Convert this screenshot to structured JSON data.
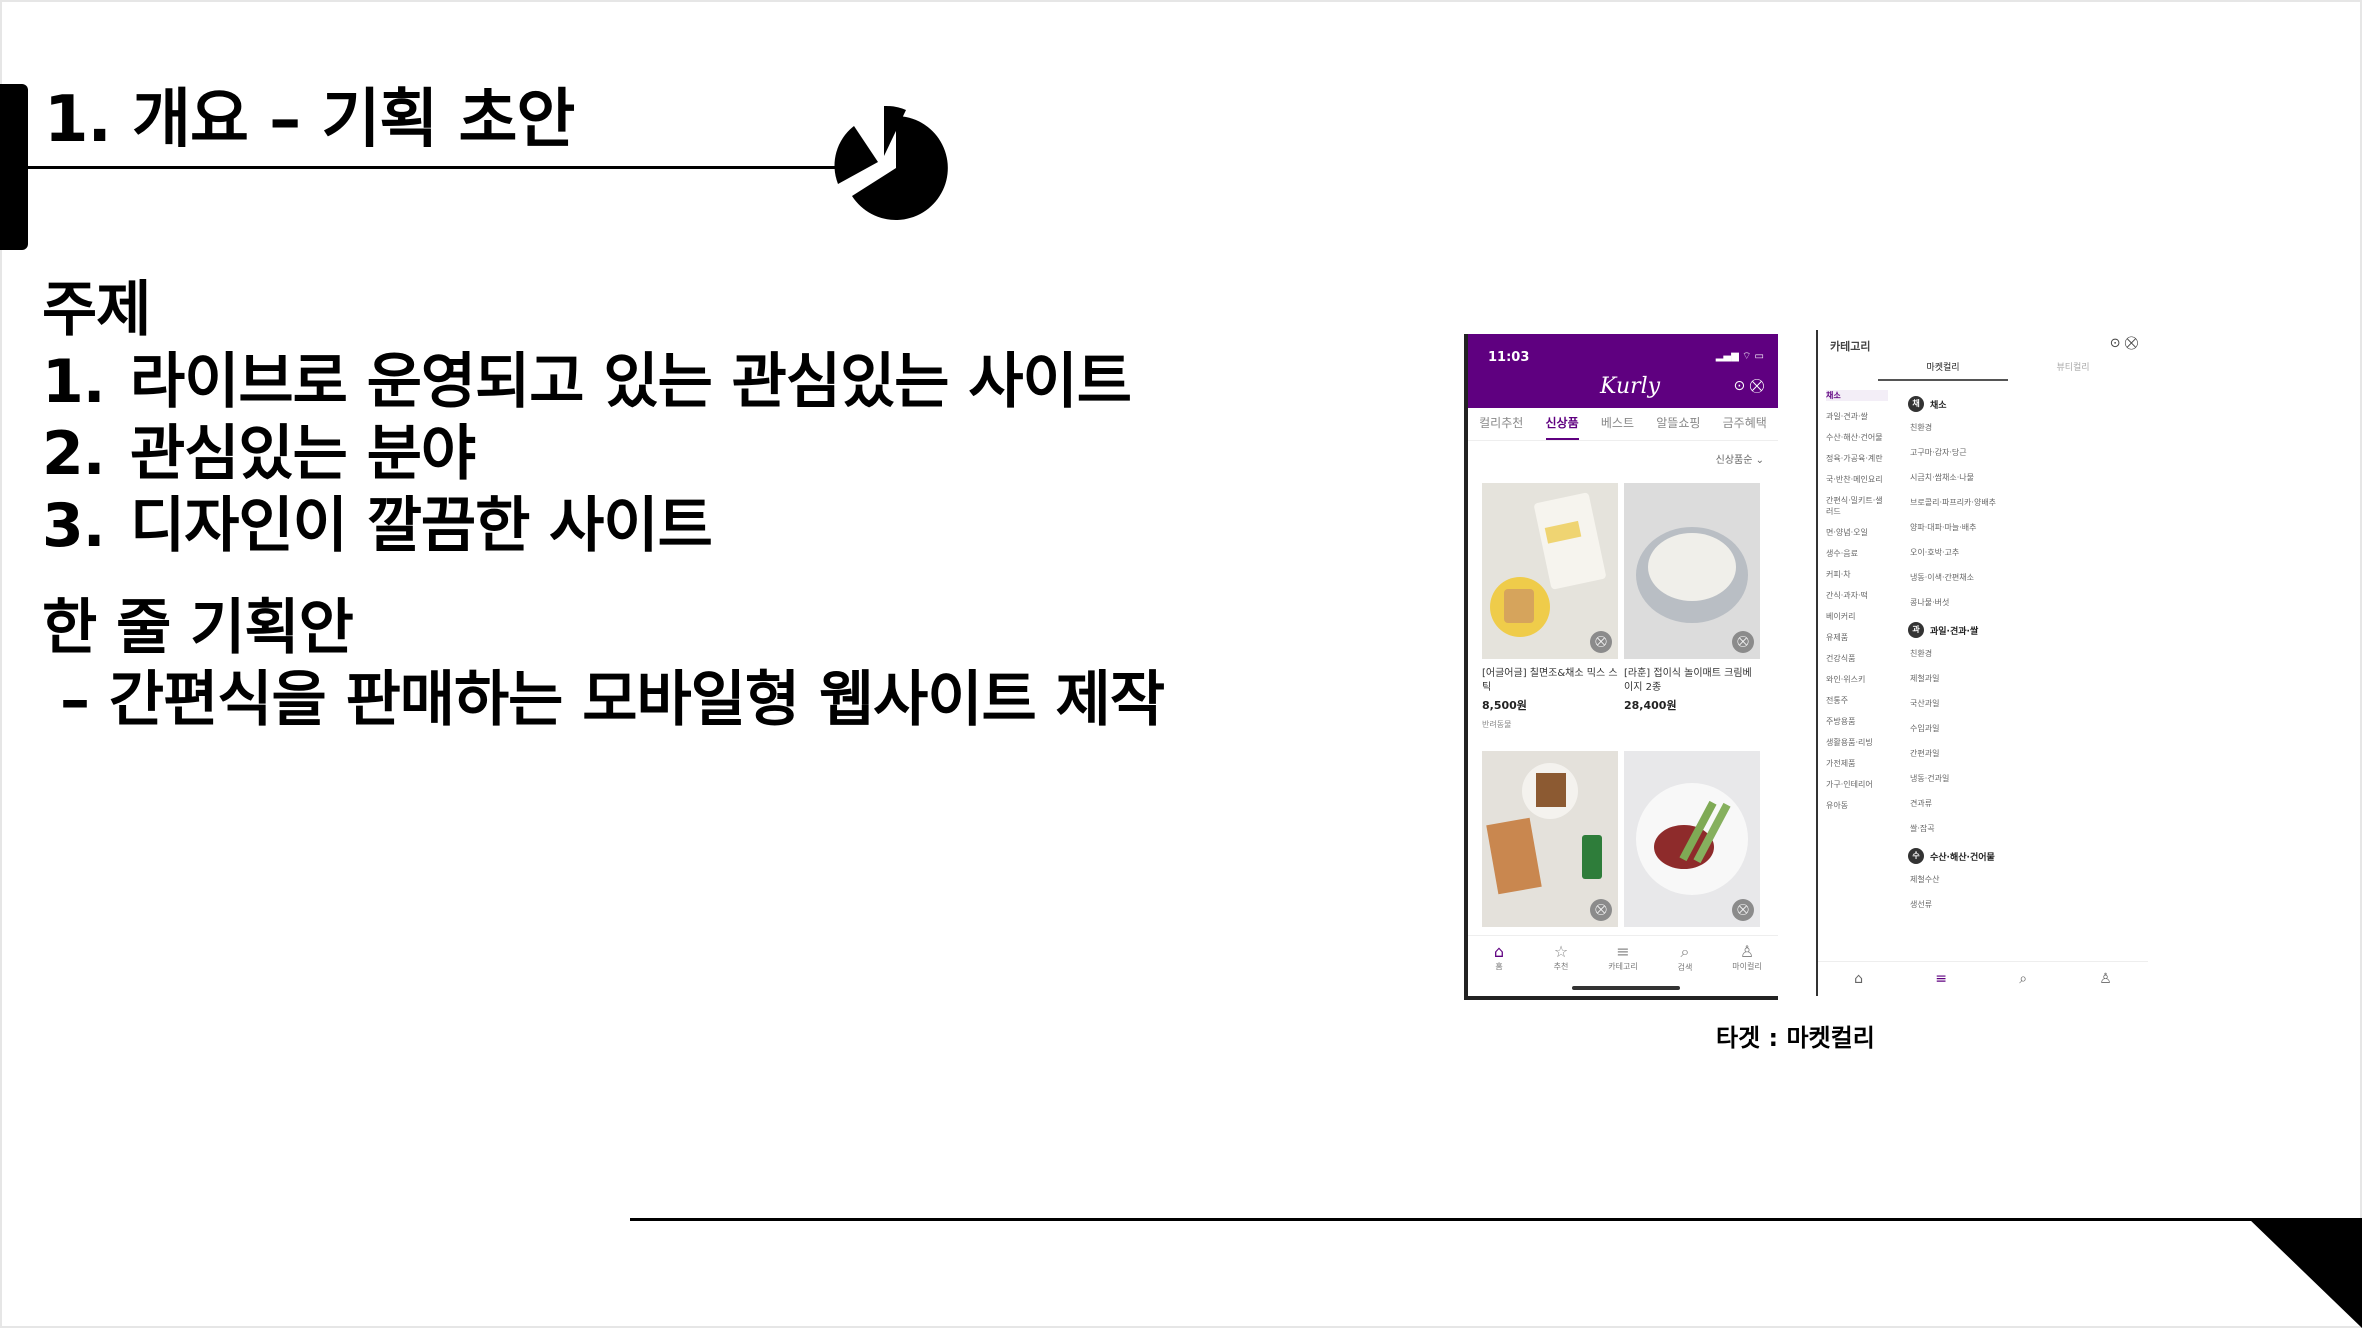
{
  "slide": {
    "title": "1. 개요 – 기획 초안",
    "topic_heading": "주제",
    "topics": [
      {
        "num": "1.",
        "text": "라이브로 운영되고 있는 관심있는 사이트"
      },
      {
        "num": "2.",
        "text": "관심있는 분야"
      },
      {
        "num": "3.",
        "text": "디자인이 깔끔한 사이트"
      }
    ],
    "plan_heading": "한 줄 기획안",
    "plan_text": "– 간편식을 판매하는 모바일형 웹사이트 제작",
    "caption": "타겟 : 마켓컬리"
  },
  "phone": {
    "time": "11:03",
    "status_icons": "▂▄▆ ⌔ ▭",
    "logo": "Kurly",
    "header_icons": "⊙ ⛒",
    "tabs": [
      "컬리추천",
      "신상품",
      "베스트",
      "알뜰쇼핑",
      "금주혜택"
    ],
    "sort_label": "신상품순 ⌄",
    "cart_glyph": "⛒",
    "products": [
      {
        "name": "[어글어글] 칠면조&채소 믹스 스틱",
        "price": "8,500원",
        "tag": "반려동물"
      },
      {
        "name": "[라훈] 접이식 놀이매트 크림베이지 2종",
        "price": "28,400원",
        "tag": ""
      },
      {
        "name": "",
        "price": "",
        "tag": ""
      },
      {
        "name": "",
        "price": "",
        "tag": ""
      }
    ],
    "nav": [
      {
        "icon": "⌂",
        "label": "홈"
      },
      {
        "icon": "☆",
        "label": "추천"
      },
      {
        "icon": "≡",
        "label": "카테고리"
      },
      {
        "icon": "⌕",
        "label": "검색"
      },
      {
        "icon": "♙",
        "label": "마이컬리"
      }
    ]
  },
  "category": {
    "title": "카테고리",
    "icons": "⊙ ⛒",
    "tabs": [
      "마켓컬리",
      "뷰티컬리"
    ],
    "left_items": [
      "채소",
      "과일·견과·쌀",
      "수산·해산·건어물",
      "정육·가공육·계란",
      "국·반찬·메인요리",
      "간편식·밀키트·샐러드",
      "면·양념·오일",
      "생수·음료",
      "커피·차",
      "간식·과자·떡",
      "베이커리",
      "유제품",
      "건강식품",
      "와인·위스키",
      "전통주",
      "주방용품",
      "생활용품·리빙",
      "가전제품",
      "가구·인테리어",
      "유아동"
    ],
    "groups": [
      {
        "icon": "채",
        "name": "채소",
        "subs": [
          "친환경",
          "고구마·감자·당근",
          "시금치·쌈채소·나물",
          "브로콜리·파프리카·양배추",
          "양파·대파·마늘·배추",
          "오이·호박·고추",
          "냉동·이색·간편채소",
          "콩나물·버섯"
        ]
      },
      {
        "icon": "과",
        "name": "과일·견과·쌀",
        "subs": [
          "친환경",
          "제철과일",
          "국산과일",
          "수입과일",
          "간편과일",
          "냉동·건과일",
          "견과류",
          "쌀·잡곡"
        ]
      },
      {
        "icon": "수",
        "name": "수산·해산·건어물",
        "subs": [
          "제철수산",
          "생선류"
        ]
      }
    ],
    "nav_icons": [
      "⌂",
      "≡",
      "⌕",
      "♙"
    ]
  }
}
